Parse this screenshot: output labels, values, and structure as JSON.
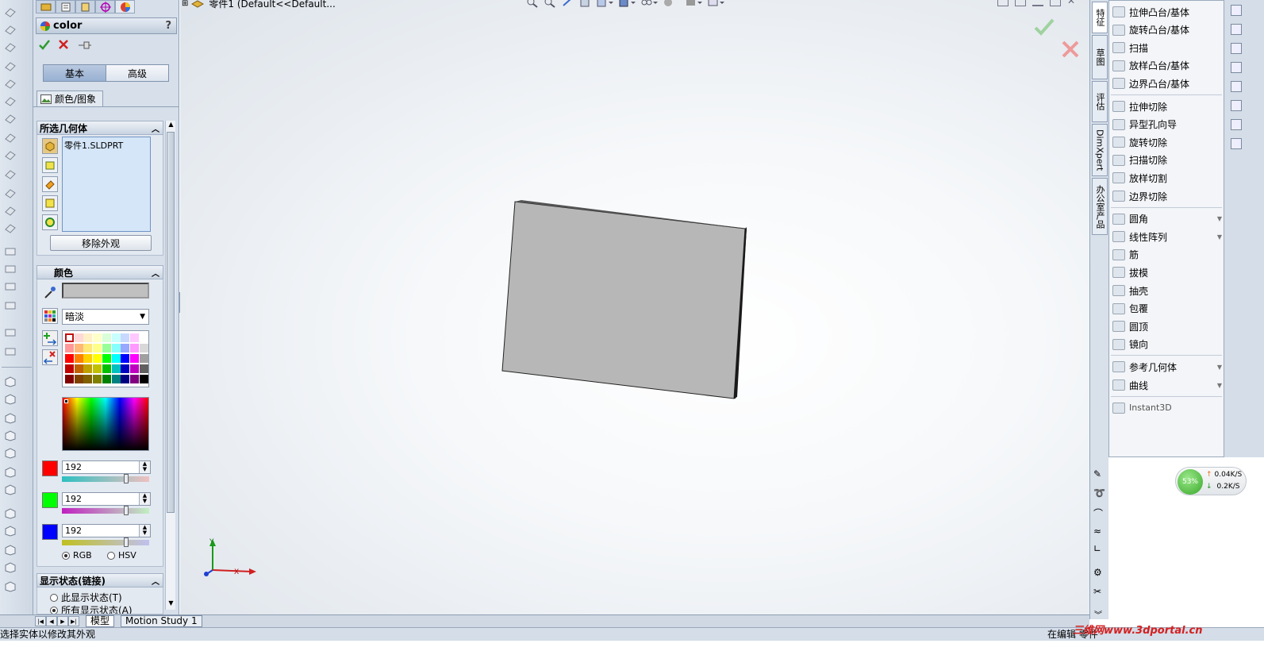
{
  "document": {
    "title": "零件1  (Default<<Default..."
  },
  "pm": {
    "title": "color",
    "help": "?",
    "mode_tabs": [
      "基本",
      "高级"
    ],
    "subtab": "颜色/图象",
    "selected_geometry": {
      "header": "所选几何体",
      "items": [
        "零件1.SLDPRT"
      ],
      "remove_button": "移除外观"
    },
    "color": {
      "header": "颜色",
      "appearance_value": "暗淡",
      "swatches": [
        [
          "#ffffff",
          "#ffd8d8",
          "#fff0c8",
          "#ffffc8",
          "#d8ffd8",
          "#c8ffff",
          "#c8d8ff",
          "#ffc8ff",
          "#ffffff"
        ],
        [
          "#ff9898",
          "#ffb878",
          "#ffe878",
          "#ffff88",
          "#98ff98",
          "#88ffff",
          "#98a8ff",
          "#ff98ff",
          "#d8d8d8"
        ],
        [
          "#ff0000",
          "#ff8000",
          "#ffd000",
          "#ffff00",
          "#00ff00",
          "#00ffff",
          "#0000ff",
          "#ff00ff",
          "#a0a0a0"
        ],
        [
          "#c00000",
          "#c06000",
          "#c0a000",
          "#c0c000",
          "#00c000",
          "#00c0c0",
          "#0000c0",
          "#c000c0",
          "#606060"
        ],
        [
          "#800000",
          "#804000",
          "#806000",
          "#808000",
          "#008000",
          "#008080",
          "#000080",
          "#800080",
          "#000000"
        ]
      ],
      "red": "192",
      "green": "192",
      "blue": "192",
      "red_level": 0.753,
      "green_level": 0.753,
      "blue_level": 0.753,
      "mode_options": [
        "RGB",
        "HSV"
      ],
      "mode_selected": "RGB"
    },
    "display_state": {
      "header": "显示状态(链接)",
      "options": [
        "此显示状态(T)",
        "所有显示状态(A)"
      ],
      "selected": "所有显示状态(A)"
    }
  },
  "right_tabs": [
    "特征",
    "草图",
    "评估",
    "DimXpert",
    "办公室产品"
  ],
  "commands": [
    {
      "label": "拉伸凸台/基体"
    },
    {
      "label": "旋转凸台/基体"
    },
    {
      "label": "扫描"
    },
    {
      "label": "放样凸台/基体"
    },
    {
      "label": "边界凸台/基体"
    },
    {
      "label": "拉伸切除"
    },
    {
      "label": "异型孔向导"
    },
    {
      "label": "旋转切除"
    },
    {
      "label": "扫描切除"
    },
    {
      "label": "放样切割"
    },
    {
      "label": "边界切除"
    },
    {
      "label": "圆角",
      "dropdown": true
    },
    {
      "label": "线性阵列",
      "dropdown": true
    },
    {
      "label": "筋"
    },
    {
      "label": "拔模"
    },
    {
      "label": "抽壳"
    },
    {
      "label": "包覆"
    },
    {
      "label": "圆顶"
    },
    {
      "label": "镜向"
    },
    {
      "label": "参考几何体",
      "dropdown": true
    },
    {
      "label": "曲线",
      "dropdown": true
    },
    {
      "label": "Instant3D"
    }
  ],
  "bottom_tabs": [
    "模型",
    "Motion Study 1"
  ],
  "status": {
    "left": "选择实体以修改其外观",
    "right": "在编辑 零件",
    "watermark": "三维网www.3dportal.cn"
  },
  "triad": {
    "x": "X",
    "y": "Y"
  },
  "net": {
    "percent": "53%",
    "up": "0.04K/S",
    "down": "0.2K/S"
  },
  "colors": {
    "accent": "#2f63b5",
    "confirm": "#2e9a2e",
    "cancel": "#d02020"
  }
}
